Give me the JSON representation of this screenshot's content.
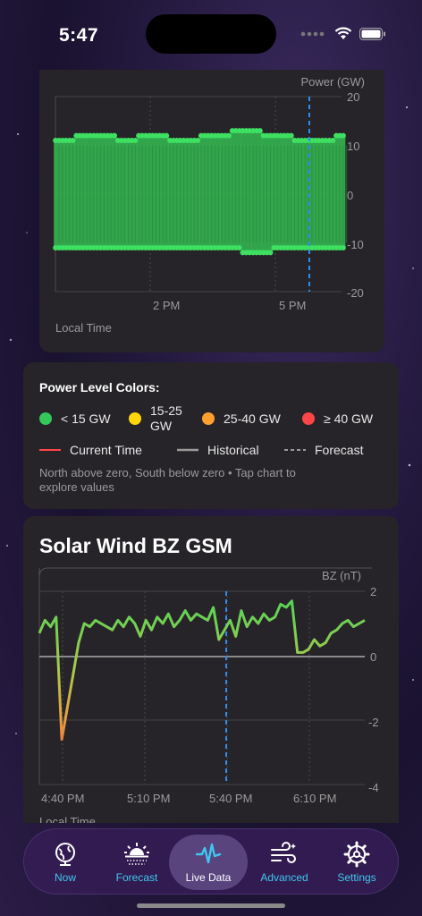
{
  "status": {
    "time": "5:47"
  },
  "power_chart": {
    "y_label": "Power (GW)",
    "y_ticks": [
      "20",
      "10",
      "0",
      "-10",
      "-20"
    ],
    "x_ticks": [
      "2 PM",
      "5 PM"
    ],
    "x_label": "Local Time"
  },
  "legend": {
    "title": "Power Level Colors:",
    "levels": [
      {
        "label": "< 15 GW",
        "color": "#34c759"
      },
      {
        "label": "15-25 GW",
        "color": "#ffd60a"
      },
      {
        "label": "25-40 GW",
        "color": "#ff9f2e"
      },
      {
        "label": "≥ 40 GW",
        "color": "#ff4545"
      }
    ],
    "lines": {
      "current": "Current Time",
      "historical": "Historical",
      "forecast": "Forecast"
    },
    "note": "North above zero, South below zero • Tap chart to explore values"
  },
  "bz_card": {
    "title": "Solar Wind BZ GSM",
    "y_label": "BZ (nT)",
    "y_ticks": [
      "2",
      "0",
      "-2",
      "-4"
    ],
    "x_ticks": [
      "4:40 PM",
      "5:10 PM",
      "5:40 PM",
      "6:10 PM"
    ],
    "x_label": "Local Time"
  },
  "tabs": [
    {
      "label": "Now",
      "icon": "globe-icon"
    },
    {
      "label": "Forecast",
      "icon": "sunrise-icon"
    },
    {
      "label": "Live Data",
      "icon": "waveform-icon"
    },
    {
      "label": "Advanced",
      "icon": "wind-icon"
    },
    {
      "label": "Settings",
      "icon": "gear-icon"
    }
  ],
  "chart_data": [
    {
      "type": "area",
      "y_label": "Power (GW)",
      "ylim": [
        -20,
        20
      ],
      "x_label": "Local Time",
      "x_ticks": [
        "2 PM",
        "5 PM"
      ],
      "series": [
        {
          "values": [
            11,
            11,
            12,
            12,
            12,
            12,
            11,
            11,
            12,
            12,
            12,
            11,
            11,
            11,
            12,
            12,
            12,
            13,
            13,
            13,
            12,
            12,
            12,
            11,
            11,
            11,
            11,
            12
          ]
        },
        {
          "values": [
            -11,
            -11,
            -11,
            -11,
            -11,
            -11,
            -11,
            -11,
            -11,
            -11,
            -11,
            -11,
            -11,
            -11,
            -11,
            -11,
            -11,
            -11,
            -12,
            -12,
            -12,
            -11,
            -11,
            -11,
            -11,
            -11,
            -11,
            -11
          ]
        }
      ]
    },
    {
      "type": "line",
      "y_label": "BZ (nT)",
      "ylim": [
        -4,
        2
      ],
      "x_label": "Local Time",
      "x_ticks": [
        "4:40 PM",
        "5:10 PM",
        "5:40 PM",
        "6:10 PM"
      ],
      "series": [
        {
          "x": [
            0,
            2,
            4,
            6,
            8,
            10,
            12,
            14,
            16,
            18,
            20,
            22,
            24,
            26,
            28,
            30,
            32,
            34,
            36,
            38,
            40,
            42,
            44,
            46,
            48,
            50,
            52,
            54,
            56,
            58,
            60,
            62,
            64,
            66,
            68,
            70,
            72,
            74,
            76,
            78,
            80,
            82,
            84,
            86,
            88,
            90,
            92,
            94,
            96,
            98,
            100,
            102,
            104,
            106,
            108,
            110,
            112,
            114,
            116
          ],
          "values": [
            0.7,
            1.1,
            0.9,
            1.2,
            -2.6,
            -1.6,
            -0.6,
            0.4,
            1.0,
            0.9,
            1.1,
            1.0,
            0.9,
            0.8,
            1.1,
            0.9,
            1.2,
            1.0,
            0.6,
            1.1,
            0.8,
            1.2,
            1.0,
            1.3,
            0.9,
            1.1,
            1.4,
            1.1,
            1.3,
            1.2,
            1.1,
            1.5,
            0.5,
            0.8,
            1.1,
            0.6,
            1.4,
            0.9,
            1.2,
            1.0,
            1.3,
            1.1,
            1.2,
            1.6,
            1.5,
            1.7,
            0.1,
            0.1,
            0.2,
            0.5,
            0.3,
            0.4,
            0.7,
            0.8,
            1.0,
            1.1,
            0.9,
            1.0,
            1.1
          ]
        }
      ]
    }
  ]
}
